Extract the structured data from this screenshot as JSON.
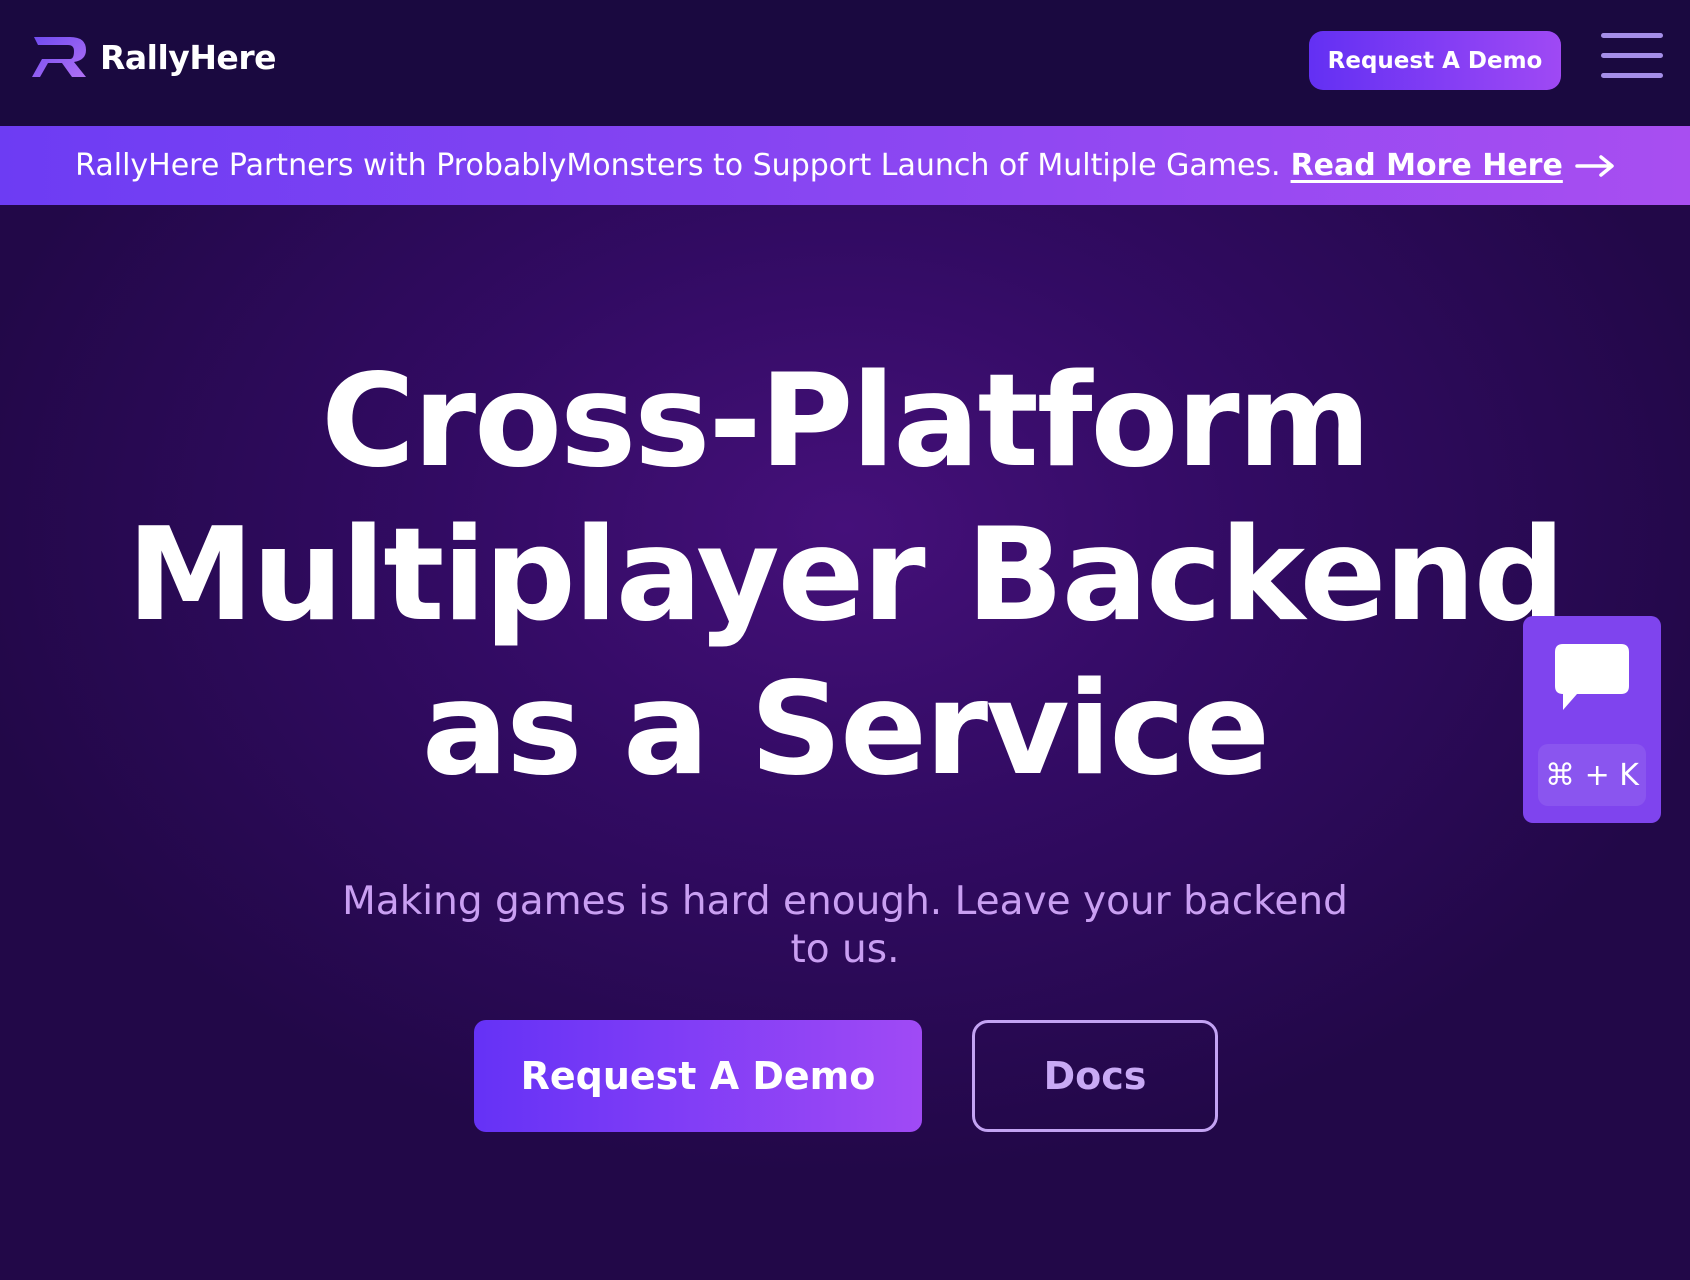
{
  "nav": {
    "logo_text": "RallyHere",
    "demo_button_label": "Request A Demo",
    "menu_icon": "hamburger-menu-icon"
  },
  "announcement": {
    "text": "RallyHere Partners with ProbablyMonsters to Support Launch of Multiple Games.",
    "link_label": "Read More Here",
    "link_icon": "arrow-right-icon"
  },
  "hero": {
    "title_line1": "Cross-Platform",
    "title_line2": "Multiplayer Backend",
    "title_line3": "as a Service",
    "subtitle": "Making games is hard enough. Leave your backend to us.",
    "primary_button_label": "Request A Demo",
    "secondary_button_label": "Docs"
  },
  "chat_widget": {
    "icon": "chat-bubble-icon",
    "shortcut": "⌘ + K"
  },
  "colors": {
    "nav_background": "#1a0940",
    "hero_background": "#320b63",
    "accent_start": "#6330f3",
    "accent_end": "#a04af5",
    "subtitle": "#c99ff2",
    "docs_border": "#c3a3f3",
    "widget": "#7f44ee"
  }
}
